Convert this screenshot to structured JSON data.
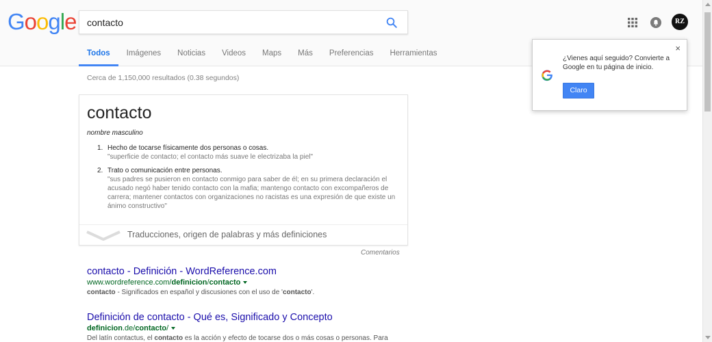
{
  "logo": {
    "letters": [
      "G",
      "o",
      "o",
      "g",
      "l",
      "e"
    ]
  },
  "search": {
    "value": "contacto"
  },
  "tabs": [
    {
      "label": "Todos"
    },
    {
      "label": "Imágenes"
    },
    {
      "label": "Noticias"
    },
    {
      "label": "Videos"
    },
    {
      "label": "Maps"
    },
    {
      "label": "Más"
    },
    {
      "label": "Preferencias"
    },
    {
      "label": "Herramientas"
    }
  ],
  "header": {
    "avatar_text": "RZ"
  },
  "result_stats": "Cerca de 1,150,000 resultados (0.38 segundos)",
  "dictionary": {
    "word": "contacto",
    "part_of_speech": "nombre masculino",
    "definitions": [
      {
        "num": "1.",
        "text": "Hecho de tocarse físicamente dos personas o cosas.",
        "example": "\"superficie de contacto; el contacto más suave le electrizaba la piel\""
      },
      {
        "num": "2.",
        "text": "Trato o comunicación entre personas.",
        "example": "\"sus padres se pusieron en contacto conmigo para saber de él; en su primera declaración el acusado negó haber tenido contacto con la mafia; mantengo contacto con excompañeros de carrera; mantener contactos con organizaciones no racistas es una expresión de que existe un ánimo constructivo\""
      }
    ],
    "more_label": "Traducciones, origen de palabras y más definiciones"
  },
  "comments_label": "Comentarios",
  "results": [
    {
      "title": "contacto - Definición - WordReference.com",
      "url_parts": [
        "www.wordreference.com/",
        "definicion",
        "/",
        "contacto"
      ],
      "snippet_parts": [
        "contacto",
        " - Significados en español y discusiones con el uso de '",
        "contacto",
        "'."
      ]
    },
    {
      "title": "Definición de contacto - Qué es, Significado y Concepto",
      "url_parts": [
        "definicion",
        ".de/",
        "contacto",
        "/"
      ],
      "snippet_parts": [
        "Del latín contactus, el ",
        "contacto",
        " es la acción y efecto de tocarse dos o más cosas o personas. Para"
      ]
    }
  ],
  "popup": {
    "message": "¿Vienes aquí seguido? Convierte a Google en tu página de inicio.",
    "button": "Claro",
    "close": "×"
  },
  "colors": {
    "accent": "#4285f4",
    "link": "#1a0dab",
    "url": "#006621"
  }
}
